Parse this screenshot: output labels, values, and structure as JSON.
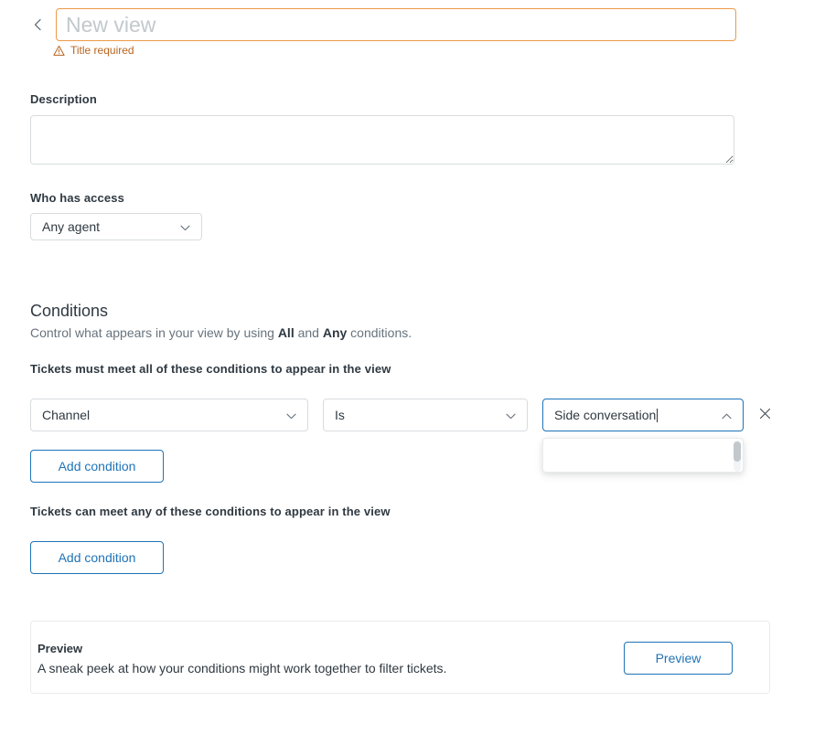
{
  "header": {
    "back_icon": "chevron-left-icon",
    "title_value": "",
    "title_placeholder": "New view",
    "error_icon": "warning-triangle-icon",
    "error_text": "Title required"
  },
  "description": {
    "label": "Description",
    "value": "",
    "placeholder": ""
  },
  "access": {
    "label": "Who has access",
    "selected": "Any agent",
    "chevron_icon": "chevron-down-icon"
  },
  "conditions": {
    "title": "Conditions",
    "subtitle_pre": "Control what appears in your view by using ",
    "subtitle_all": "All",
    "subtitle_mid": " and ",
    "subtitle_any": "Any",
    "subtitle_post": " conditions.",
    "all_heading": "Tickets must meet all of these conditions to appear in the view",
    "any_heading": "Tickets can meet any of these conditions to appear in the view",
    "all_rows": [
      {
        "field": "Channel",
        "field_chevron_icon": "chevron-down-icon",
        "operator": "Is",
        "operator_chevron_icon": "chevron-down-icon",
        "value": "Side conversation",
        "value_chevron_icon": "chevron-up-icon",
        "remove_icon": "close-icon",
        "menu_open": true,
        "menu_items": []
      }
    ],
    "add_condition_all_label": "Add condition",
    "add_condition_any_label": "Add condition"
  },
  "preview": {
    "title": "Preview",
    "description": "A sneak peek at how your conditions might work together to filter tickets.",
    "button_label": "Preview"
  },
  "colors": {
    "accent_blue": "#1f73b7",
    "error_orange": "#ed9a47",
    "error_text": "#b8641e",
    "text_primary": "#2f3941",
    "text_secondary": "#68737d",
    "border_grey": "#d8dcde"
  }
}
